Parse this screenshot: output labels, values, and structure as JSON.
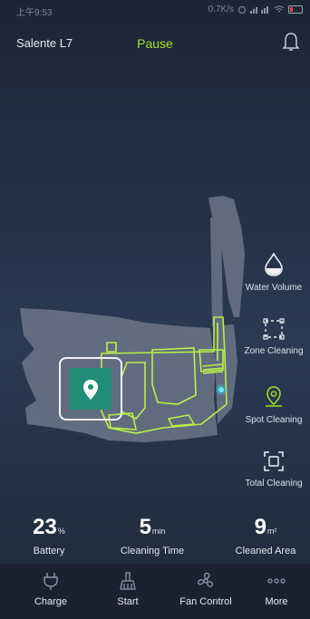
{
  "status_bar": {
    "time": "上午9:53",
    "speed": "0.7K/s"
  },
  "header": {
    "device_name": "Salente L7",
    "state": "Pause"
  },
  "actions": [
    {
      "label": "Water Volume",
      "icon": "water-drop-icon"
    },
    {
      "label": "Zone Cleaning",
      "icon": "zone-icon"
    },
    {
      "label": "Spot Cleaning",
      "icon": "spot-pin-icon"
    },
    {
      "label": "Total Cleaning",
      "icon": "total-icon"
    }
  ],
  "stats": {
    "battery": {
      "value": "23",
      "unit": "%",
      "label": "Battery"
    },
    "time": {
      "value": "5",
      "unit": "min",
      "label": "Cleaning Time"
    },
    "area": {
      "value": "9",
      "unit": "m²",
      "label": "Cleaned Area"
    }
  },
  "nav": [
    {
      "label": "Charge",
      "icon": "plug-icon"
    },
    {
      "label": "Start",
      "icon": "broom-icon"
    },
    {
      "label": "Fan Control",
      "icon": "fan-icon"
    },
    {
      "label": "More",
      "icon": "more-icon"
    }
  ],
  "colors": {
    "accent": "#a6e22e",
    "spot": "#1f8d78",
    "background": "#1d2838"
  }
}
